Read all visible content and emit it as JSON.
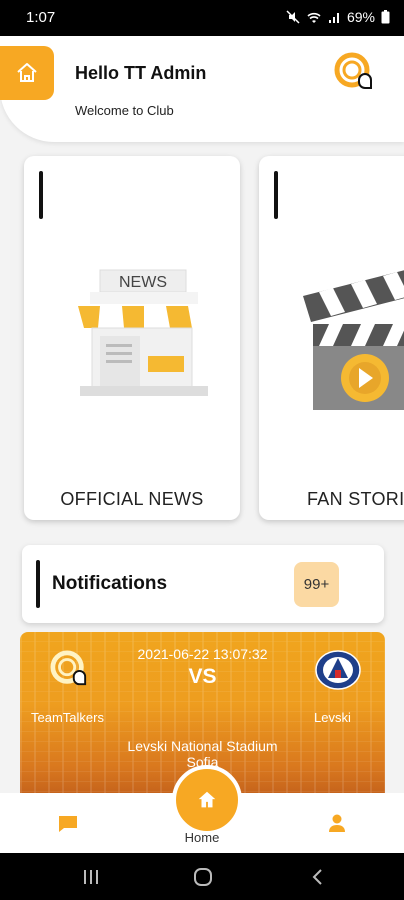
{
  "status": {
    "time": "1:07",
    "battery": "69%"
  },
  "header": {
    "greeting": "Hello TT Admin",
    "subtitle": "Welcome to Club"
  },
  "cards": [
    {
      "label": "OFFICIAL NEWS",
      "sign": "NEWS",
      "icon": "news-stand-icon"
    },
    {
      "label": "FAN STORIES",
      "icon": "clapperboard-icon"
    }
  ],
  "notifications": {
    "title": "Notifications",
    "badge": "99+"
  },
  "match": {
    "datetime": "2021-06-22 13:07:32",
    "vs": "VS",
    "home_team": "TeamTalkers",
    "away_team": "Levski",
    "venue_line1": "Levski National Stadium",
    "venue_line2": "Sofia"
  },
  "bottom_nav": {
    "home_label": "Home"
  },
  "colors": {
    "accent": "#f7a823",
    "badge_bg": "#fbd9a3"
  }
}
